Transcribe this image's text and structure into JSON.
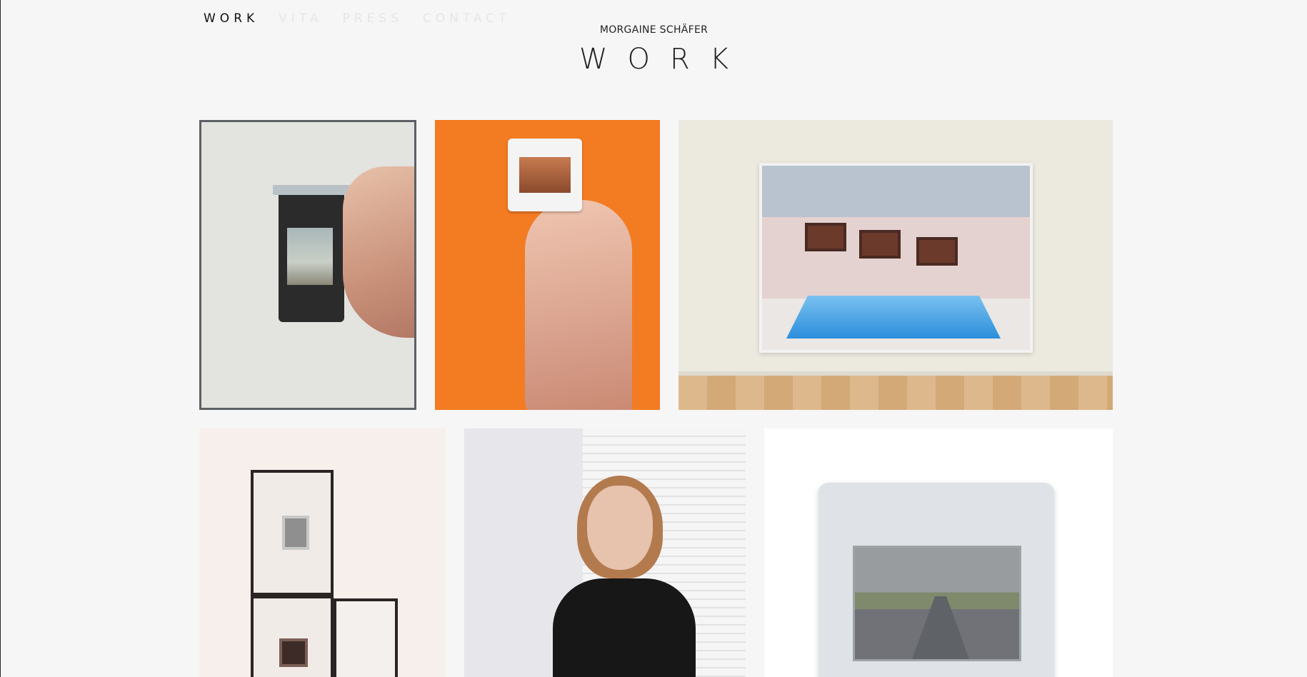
{
  "nav": {
    "items": [
      {
        "label": "WORK",
        "active": true
      },
      {
        "label": "VITA",
        "active": false
      },
      {
        "label": "PRESS",
        "active": false
      },
      {
        "label": "CONTACT",
        "active": false
      }
    ]
  },
  "header": {
    "artist_name": "MORGAINE SCHÄFER",
    "page_title": "WORK"
  },
  "gallery": {
    "tiles": [
      {
        "subject": "slide held against wall with shadow",
        "selected": true
      },
      {
        "subject": "hand holding slide on orange background"
      },
      {
        "subject": "framed photograph of indoor pool on gallery wall"
      },
      {
        "subject": "framed slides installation"
      },
      {
        "subject": "portrait of woman in black sweater"
      },
      {
        "subject": "slide showing highway view"
      }
    ]
  },
  "colors": {
    "background": "#f6f6f6",
    "text": "#222222",
    "nav_inactive": "#e6e6e6",
    "orange": "#f37b22"
  }
}
